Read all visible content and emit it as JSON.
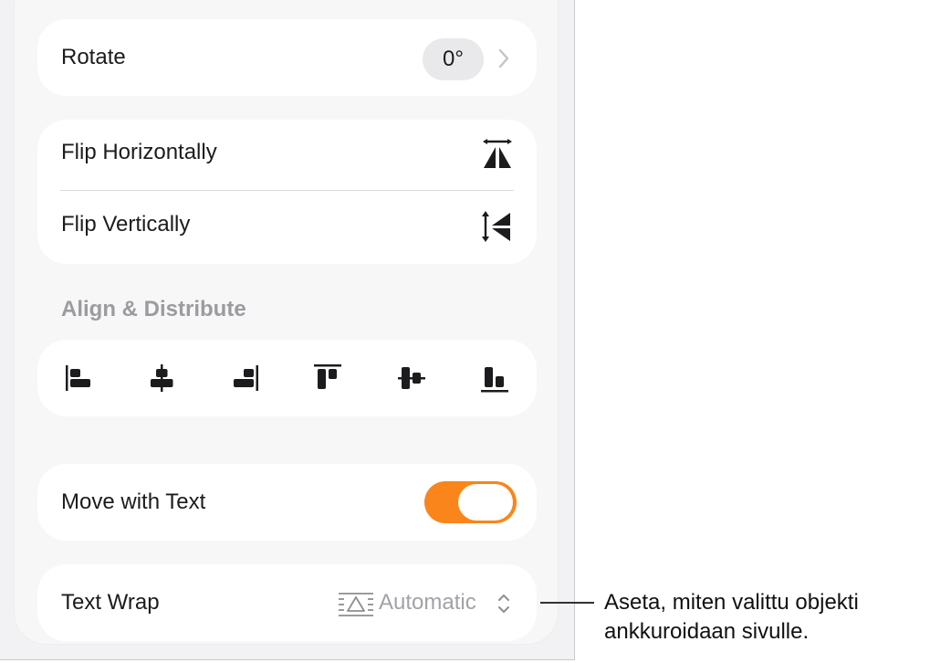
{
  "rotate": {
    "label": "Rotate",
    "value": "0°"
  },
  "flip": {
    "horizontal_label": "Flip Horizontally",
    "vertical_label": "Flip Vertically"
  },
  "align": {
    "title": "Align & Distribute",
    "buttons": [
      {
        "icon": "align-left-icon"
      },
      {
        "icon": "align-center-icon"
      },
      {
        "icon": "align-right-icon"
      },
      {
        "icon": "align-top-icon"
      },
      {
        "icon": "align-middle-icon"
      },
      {
        "icon": "align-bottom-icon"
      }
    ]
  },
  "move_with_text": {
    "label": "Move with Text",
    "on": true
  },
  "text_wrap": {
    "label": "Text Wrap",
    "value": "Automatic"
  },
  "callout": {
    "line1": "Aseta, miten valittu objekti",
    "line2": "ankkuroidaan sivulle."
  },
  "colors": {
    "accent": "#f9851b",
    "card": "#ffffff",
    "panel": "#f7f7f8",
    "secondary_text": "#9b9ba0"
  }
}
